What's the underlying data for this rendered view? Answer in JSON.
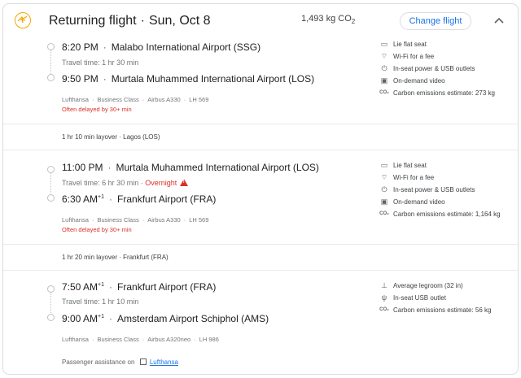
{
  "header": {
    "title": "Returning flight",
    "date": "Sun, Oct 8",
    "co2_value": "1,493 kg CO",
    "co2_sub": "2",
    "change_label": "Change flight"
  },
  "legs": [
    {
      "dep_time": "8:20 PM",
      "dep_airport": "Malabo International Airport (SSG)",
      "travel_time": "Travel time: 1 hr 30 min",
      "arr_time": "9:50 PM",
      "arr_airport": "Murtala Muhammed International Airport (LOS)",
      "airline": "Lufthansa",
      "cabin": "Business Class",
      "aircraft": "Airbus A330",
      "flight_no": "LH 569",
      "delay": "Often delayed by 30+ min",
      "amenities": [
        "Lie flat seat",
        "Wi-Fi for a fee",
        "In-seat power & USB outlets",
        "On-demand video",
        "Carbon emissions estimate: 273 kg"
      ]
    },
    {
      "dep_time": "11:00 PM",
      "dep_airport": "Murtala Muhammed International Airport (LOS)",
      "travel_time": "Travel time: 6 hr 30 min",
      "overnight": "Overnight",
      "arr_time": "6:30 AM",
      "arr_plus": "+1",
      "arr_airport": "Frankfurt Airport (FRA)",
      "airline": "Lufthansa",
      "cabin": "Business Class",
      "aircraft": "Airbus A330",
      "flight_no": "LH 569",
      "delay": "Often delayed by 30+ min",
      "amenities": [
        "Lie flat seat",
        "Wi-Fi for a fee",
        "In-seat power & USB outlets",
        "On-demand video",
        "Carbon emissions estimate: 1,164 kg"
      ]
    },
    {
      "dep_time": "7:50 AM",
      "dep_plus": "+1",
      "dep_airport": "Frankfurt Airport (FRA)",
      "travel_time": "Travel time: 1 hr 10 min",
      "arr_time": "9:00 AM",
      "arr_plus": "+1",
      "arr_airport": "Amsterdam Airport Schiphol (AMS)",
      "airline": "Lufthansa",
      "cabin": "Business Class",
      "aircraft": "Airbus A320neo",
      "flight_no": "LH 986",
      "amenities": [
        "Average legroom (32 in)",
        "In-seat USB outlet",
        "Carbon emissions estimate: 56 kg"
      ]
    }
  ],
  "layovers": [
    "1 hr 10 min layover · Lagos (LOS)",
    "1 hr 20 min layover · Frankfurt (FRA)"
  ],
  "assistance": {
    "label": "Passenger assistance on",
    "link": "Lufthansa"
  },
  "colors": {
    "accent": "#1a73e8",
    "warning": "#d93025",
    "logo": "#f3a700"
  }
}
